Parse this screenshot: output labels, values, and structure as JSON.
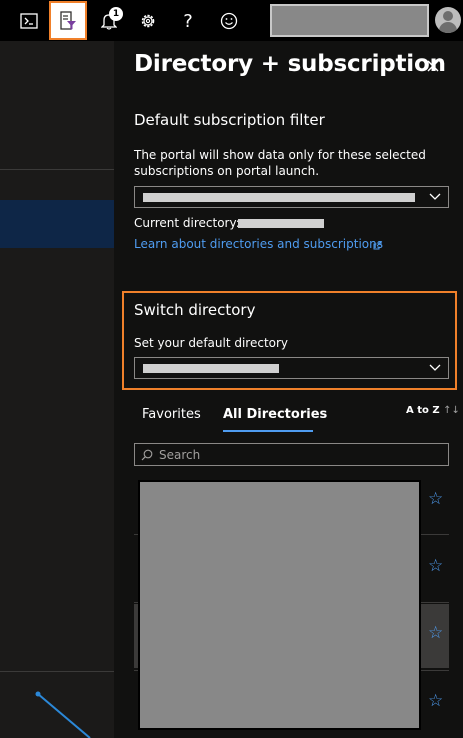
{
  "topbar": {
    "icons": [
      "cloud-shell-icon",
      "directory-filter-icon",
      "notifications-icon",
      "settings-icon",
      "help-icon",
      "feedback-icon"
    ],
    "notification_count": "1",
    "help_glyph": "?"
  },
  "panel": {
    "title": "Directory + subscription",
    "default_filter": {
      "heading": "Default subscription filter",
      "description": "The portal will show data only for these selected subscriptions on portal launch.",
      "current_directory_label": "Current directory:",
      "learn_link": "Learn about directories and subscriptions"
    },
    "switch_directory": {
      "heading": "Switch directory",
      "sublabel": "Set your default directory"
    },
    "tabs": [
      {
        "label": "Favorites",
        "active": false
      },
      {
        "label": "All Directories",
        "active": true
      }
    ],
    "sort_label": "A to Z",
    "sort_arrows": "↑↓",
    "search_placeholder": "Search"
  },
  "colors": {
    "accent_orange": "#f0802a",
    "link_blue": "#4f9cf0",
    "panel_bg": "#111110",
    "topbar_bg": "#000000"
  }
}
